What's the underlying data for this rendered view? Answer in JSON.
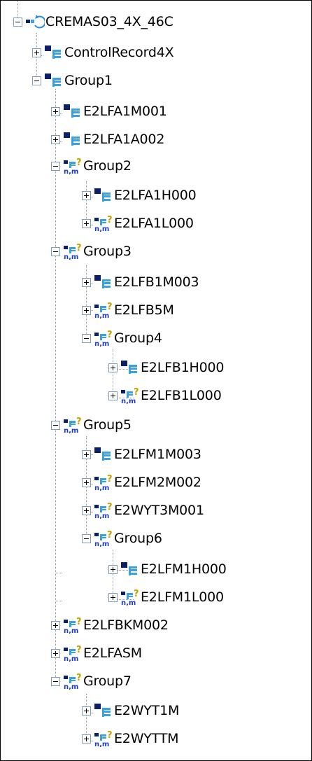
{
  "tree": {
    "root": {
      "label": "CREMAS03_4X_46C",
      "icon": "idoc-basic-type-icon",
      "expanded": true
    },
    "items": [
      {
        "label": "ControlRecord4X",
        "icon": "segment-icon",
        "expanded": false,
        "level": 1
      },
      {
        "label": "Group1",
        "icon": "segment-icon",
        "expanded": true,
        "level": 1
      },
      {
        "label": "E2LFA1M001",
        "icon": "segment-icon",
        "expanded": false,
        "level": 2
      },
      {
        "label": "E2LFA1A002",
        "icon": "segment-icon",
        "expanded": false,
        "level": 2
      },
      {
        "label": "Group2",
        "icon": "optional-multiple-segment-icon",
        "expanded": true,
        "level": 2
      },
      {
        "label": "E2LFA1H000",
        "icon": "segment-icon",
        "expanded": false,
        "level": 3
      },
      {
        "label": "E2LFA1L000",
        "icon": "optional-multiple-segment-icon",
        "expanded": false,
        "level": 3
      },
      {
        "label": "Group3",
        "icon": "optional-multiple-segment-icon",
        "expanded": true,
        "level": 2
      },
      {
        "label": "E2LFB1M003",
        "icon": "segment-icon",
        "expanded": false,
        "level": 3
      },
      {
        "label": "E2LFB5M",
        "icon": "optional-multiple-segment-icon",
        "expanded": false,
        "level": 3
      },
      {
        "label": "Group4",
        "icon": "optional-multiple-segment-icon",
        "expanded": true,
        "level": 3
      },
      {
        "label": "E2LFB1H000",
        "icon": "segment-icon",
        "expanded": false,
        "level": 4
      },
      {
        "label": "E2LFB1L000",
        "icon": "optional-multiple-segment-icon",
        "expanded": false,
        "level": 4
      },
      {
        "label": "Group5",
        "icon": "optional-multiple-segment-icon",
        "expanded": true,
        "level": 2
      },
      {
        "label": "E2LFM1M003",
        "icon": "segment-icon",
        "expanded": false,
        "level": 3
      },
      {
        "label": "E2LFM2M002",
        "icon": "optional-multiple-segment-icon",
        "expanded": false,
        "level": 3
      },
      {
        "label": "E2WYT3M001",
        "icon": "optional-multiple-segment-icon",
        "expanded": false,
        "level": 3
      },
      {
        "label": "Group6",
        "icon": "optional-multiple-segment-icon",
        "expanded": true,
        "level": 3
      },
      {
        "label": "E2LFM1H000",
        "icon": "segment-icon",
        "expanded": false,
        "level": 4
      },
      {
        "label": "E2LFM1L000",
        "icon": "optional-multiple-segment-icon",
        "expanded": false,
        "level": 4
      },
      {
        "label": "E2LFBKM002",
        "icon": "optional-multiple-segment-icon",
        "expanded": false,
        "level": 2
      },
      {
        "label": "E2LFASM",
        "icon": "optional-multiple-segment-icon",
        "expanded": false,
        "level": 2
      },
      {
        "label": "Group7",
        "icon": "optional-multiple-segment-icon",
        "expanded": true,
        "level": 2
      },
      {
        "label": "E2WYT1M",
        "icon": "segment-icon",
        "expanded": false,
        "level": 3
      },
      {
        "label": "E2WYTTM",
        "icon": "optional-multiple-segment-icon",
        "expanded": false,
        "level": 3
      }
    ]
  },
  "icon_glyphs": {
    "optional_marker": "?",
    "cardinality_marker": "n,m"
  },
  "colors": {
    "segment_dark": "#0a1e6e",
    "segment_light": "#3aa0e0",
    "optional_marker": "#c8a000",
    "cardinality_marker": "#1a3cc8",
    "root_icon": "#2a8ad8",
    "tree_lines": "#9a9a9a",
    "toggle_border": "#7f9db9"
  }
}
